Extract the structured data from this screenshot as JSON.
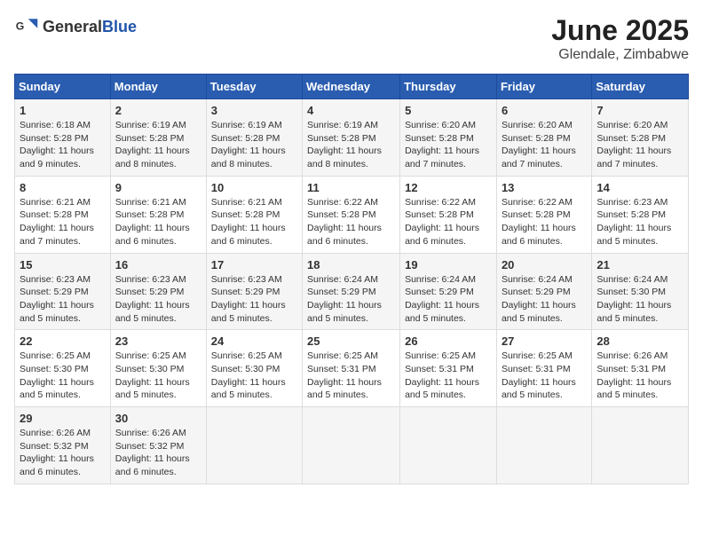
{
  "header": {
    "logo_general": "General",
    "logo_blue": "Blue",
    "month": "June 2025",
    "location": "Glendale, Zimbabwe"
  },
  "weekdays": [
    "Sunday",
    "Monday",
    "Tuesday",
    "Wednesday",
    "Thursday",
    "Friday",
    "Saturday"
  ],
  "weeks": [
    [
      {
        "day": "1",
        "sunrise": "Sunrise: 6:18 AM",
        "sunset": "Sunset: 5:28 PM",
        "daylight": "Daylight: 11 hours and 9 minutes."
      },
      {
        "day": "2",
        "sunrise": "Sunrise: 6:19 AM",
        "sunset": "Sunset: 5:28 PM",
        "daylight": "Daylight: 11 hours and 8 minutes."
      },
      {
        "day": "3",
        "sunrise": "Sunrise: 6:19 AM",
        "sunset": "Sunset: 5:28 PM",
        "daylight": "Daylight: 11 hours and 8 minutes."
      },
      {
        "day": "4",
        "sunrise": "Sunrise: 6:19 AM",
        "sunset": "Sunset: 5:28 PM",
        "daylight": "Daylight: 11 hours and 8 minutes."
      },
      {
        "day": "5",
        "sunrise": "Sunrise: 6:20 AM",
        "sunset": "Sunset: 5:28 PM",
        "daylight": "Daylight: 11 hours and 7 minutes."
      },
      {
        "day": "6",
        "sunrise": "Sunrise: 6:20 AM",
        "sunset": "Sunset: 5:28 PM",
        "daylight": "Daylight: 11 hours and 7 minutes."
      },
      {
        "day": "7",
        "sunrise": "Sunrise: 6:20 AM",
        "sunset": "Sunset: 5:28 PM",
        "daylight": "Daylight: 11 hours and 7 minutes."
      }
    ],
    [
      {
        "day": "8",
        "sunrise": "Sunrise: 6:21 AM",
        "sunset": "Sunset: 5:28 PM",
        "daylight": "Daylight: 11 hours and 7 minutes."
      },
      {
        "day": "9",
        "sunrise": "Sunrise: 6:21 AM",
        "sunset": "Sunset: 5:28 PM",
        "daylight": "Daylight: 11 hours and 6 minutes."
      },
      {
        "day": "10",
        "sunrise": "Sunrise: 6:21 AM",
        "sunset": "Sunset: 5:28 PM",
        "daylight": "Daylight: 11 hours and 6 minutes."
      },
      {
        "day": "11",
        "sunrise": "Sunrise: 6:22 AM",
        "sunset": "Sunset: 5:28 PM",
        "daylight": "Daylight: 11 hours and 6 minutes."
      },
      {
        "day": "12",
        "sunrise": "Sunrise: 6:22 AM",
        "sunset": "Sunset: 5:28 PM",
        "daylight": "Daylight: 11 hours and 6 minutes."
      },
      {
        "day": "13",
        "sunrise": "Sunrise: 6:22 AM",
        "sunset": "Sunset: 5:28 PM",
        "daylight": "Daylight: 11 hours and 6 minutes."
      },
      {
        "day": "14",
        "sunrise": "Sunrise: 6:23 AM",
        "sunset": "Sunset: 5:28 PM",
        "daylight": "Daylight: 11 hours and 5 minutes."
      }
    ],
    [
      {
        "day": "15",
        "sunrise": "Sunrise: 6:23 AM",
        "sunset": "Sunset: 5:29 PM",
        "daylight": "Daylight: 11 hours and 5 minutes."
      },
      {
        "day": "16",
        "sunrise": "Sunrise: 6:23 AM",
        "sunset": "Sunset: 5:29 PM",
        "daylight": "Daylight: 11 hours and 5 minutes."
      },
      {
        "day": "17",
        "sunrise": "Sunrise: 6:23 AM",
        "sunset": "Sunset: 5:29 PM",
        "daylight": "Daylight: 11 hours and 5 minutes."
      },
      {
        "day": "18",
        "sunrise": "Sunrise: 6:24 AM",
        "sunset": "Sunset: 5:29 PM",
        "daylight": "Daylight: 11 hours and 5 minutes."
      },
      {
        "day": "19",
        "sunrise": "Sunrise: 6:24 AM",
        "sunset": "Sunset: 5:29 PM",
        "daylight": "Daylight: 11 hours and 5 minutes."
      },
      {
        "day": "20",
        "sunrise": "Sunrise: 6:24 AM",
        "sunset": "Sunset: 5:29 PM",
        "daylight": "Daylight: 11 hours and 5 minutes."
      },
      {
        "day": "21",
        "sunrise": "Sunrise: 6:24 AM",
        "sunset": "Sunset: 5:30 PM",
        "daylight": "Daylight: 11 hours and 5 minutes."
      }
    ],
    [
      {
        "day": "22",
        "sunrise": "Sunrise: 6:25 AM",
        "sunset": "Sunset: 5:30 PM",
        "daylight": "Daylight: 11 hours and 5 minutes."
      },
      {
        "day": "23",
        "sunrise": "Sunrise: 6:25 AM",
        "sunset": "Sunset: 5:30 PM",
        "daylight": "Daylight: 11 hours and 5 minutes."
      },
      {
        "day": "24",
        "sunrise": "Sunrise: 6:25 AM",
        "sunset": "Sunset: 5:30 PM",
        "daylight": "Daylight: 11 hours and 5 minutes."
      },
      {
        "day": "25",
        "sunrise": "Sunrise: 6:25 AM",
        "sunset": "Sunset: 5:31 PM",
        "daylight": "Daylight: 11 hours and 5 minutes."
      },
      {
        "day": "26",
        "sunrise": "Sunrise: 6:25 AM",
        "sunset": "Sunset: 5:31 PM",
        "daylight": "Daylight: 11 hours and 5 minutes."
      },
      {
        "day": "27",
        "sunrise": "Sunrise: 6:25 AM",
        "sunset": "Sunset: 5:31 PM",
        "daylight": "Daylight: 11 hours and 5 minutes."
      },
      {
        "day": "28",
        "sunrise": "Sunrise: 6:26 AM",
        "sunset": "Sunset: 5:31 PM",
        "daylight": "Daylight: 11 hours and 5 minutes."
      }
    ],
    [
      {
        "day": "29",
        "sunrise": "Sunrise: 6:26 AM",
        "sunset": "Sunset: 5:32 PM",
        "daylight": "Daylight: 11 hours and 6 minutes."
      },
      {
        "day": "30",
        "sunrise": "Sunrise: 6:26 AM",
        "sunset": "Sunset: 5:32 PM",
        "daylight": "Daylight: 11 hours and 6 minutes."
      },
      null,
      null,
      null,
      null,
      null
    ]
  ]
}
